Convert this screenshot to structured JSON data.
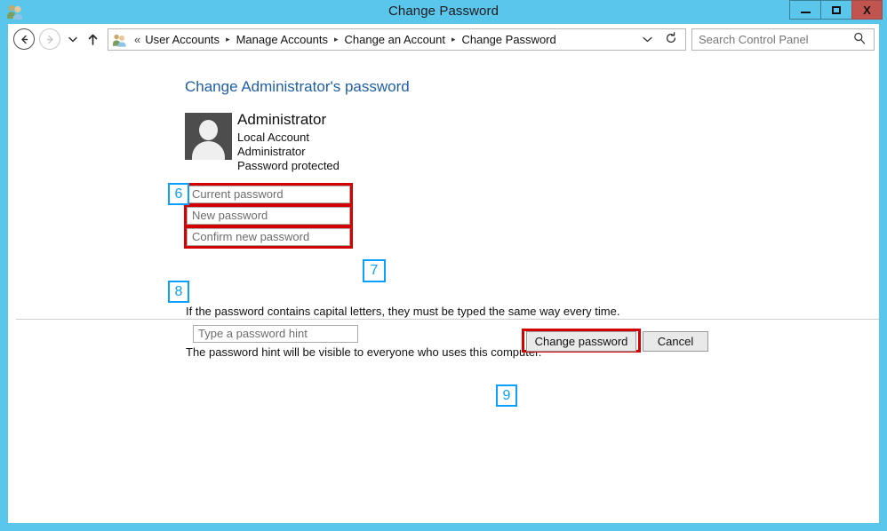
{
  "window": {
    "title": "Change Password",
    "icon": "user-accounts-icon",
    "controls": {
      "minimize": "–",
      "maximize": "□",
      "close": "X"
    },
    "frame_color": "#5bc6ec",
    "close_color": "#c25450"
  },
  "navbar": {
    "back": "←",
    "forward": "→",
    "recent_caret": "▾",
    "up": "↑",
    "breadcrumb": {
      "icon": "user-accounts-icon",
      "overflow": "«",
      "segments": [
        "User Accounts",
        "Manage Accounts",
        "Change an Account",
        "Change Password"
      ],
      "separator": "▸",
      "dropdown": "⌄",
      "refresh": "↻"
    },
    "search": {
      "placeholder": "Search Control Panel",
      "icon": "search-icon"
    }
  },
  "main": {
    "page_title": "Change Administrator's password",
    "account": {
      "avatar": "user-avatar",
      "name": "Administrator",
      "type": "Local Account",
      "group": "Administrator",
      "status": "Password protected"
    },
    "fields": {
      "current_password": {
        "placeholder": "Current password",
        "value": ""
      },
      "new_password": {
        "placeholder": "New password",
        "value": ""
      },
      "confirm_password": {
        "placeholder": "Confirm new password",
        "value": ""
      },
      "hint": {
        "placeholder": "Type a password hint",
        "value": ""
      }
    },
    "notes": {
      "caps": "If the password contains capital letters, they must be typed the same way every time.",
      "hint_visibility": "The password hint will be visible to everyone who uses this computer."
    },
    "buttons": {
      "change_password": "Change password",
      "cancel": "Cancel"
    }
  },
  "annotations": {
    "badge_color": "#0aa0ff",
    "highlight_color": "#d40000",
    "steps": {
      "current_password": "6",
      "new_password": "7",
      "confirm_password": "8",
      "change_button": "9"
    }
  }
}
